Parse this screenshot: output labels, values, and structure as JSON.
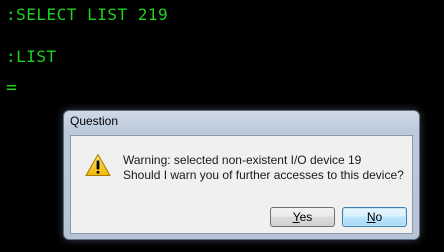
{
  "terminal": {
    "lines": [
      ":SELECT LIST 219",
      ":LIST",
      "="
    ]
  },
  "dialog": {
    "title": "Question",
    "icon": "warning-icon",
    "message_line1": "Warning: selected non-existent I/O device 19",
    "message_line2": "Should I warn you of further accesses to this device?",
    "buttons": {
      "yes_mnemonic": "Y",
      "yes_rest": "es",
      "no_mnemonic": "N",
      "no_rest": "o"
    }
  },
  "colors": {
    "terminal_text": "#1fd11f",
    "terminal_bg": "#000000",
    "warning_yellow": "#f4c81b"
  }
}
